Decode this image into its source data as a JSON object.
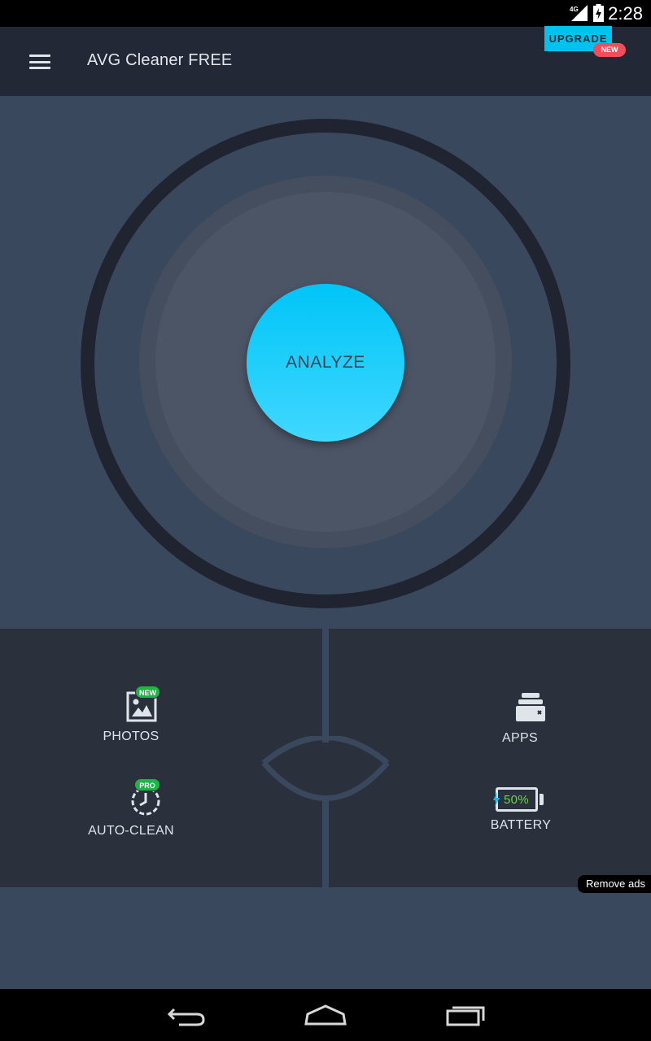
{
  "status_bar": {
    "time": "2:28",
    "network": "4G"
  },
  "toolbar": {
    "title": "AVG Cleaner FREE",
    "upgrade_label": "UPGRADE",
    "upgrade_badge": "NEW"
  },
  "hero": {
    "analyze_label": "ANALYZE"
  },
  "features": {
    "photos": {
      "label": "PHOTOS",
      "badge": "NEW"
    },
    "auto_clean": {
      "label": "AUTO-CLEAN",
      "badge": "PRO"
    },
    "apps": {
      "label": "APPS"
    },
    "battery": {
      "label": "BATTERY",
      "level": "50%"
    }
  },
  "ads": {
    "remove_label": "Remove ads"
  },
  "colors": {
    "accent": "#00c2ef",
    "toolbar_bg": "#222835",
    "hero_bg": "#3a485d",
    "tile_bg": "#2b303d",
    "badge_red": "#ef4e5a",
    "badge_green": "#1cb742",
    "battery_fill": "#6cd24a"
  },
  "icons": {
    "menu": "hamburger-menu-icon",
    "photos": "image-icon",
    "auto_clean": "timer-clock-icon",
    "apps": "app-stack-icon",
    "battery": "battery-icon",
    "nav_back": "back-arrow-icon",
    "nav_home": "home-icon",
    "nav_recents": "recents-icon"
  }
}
